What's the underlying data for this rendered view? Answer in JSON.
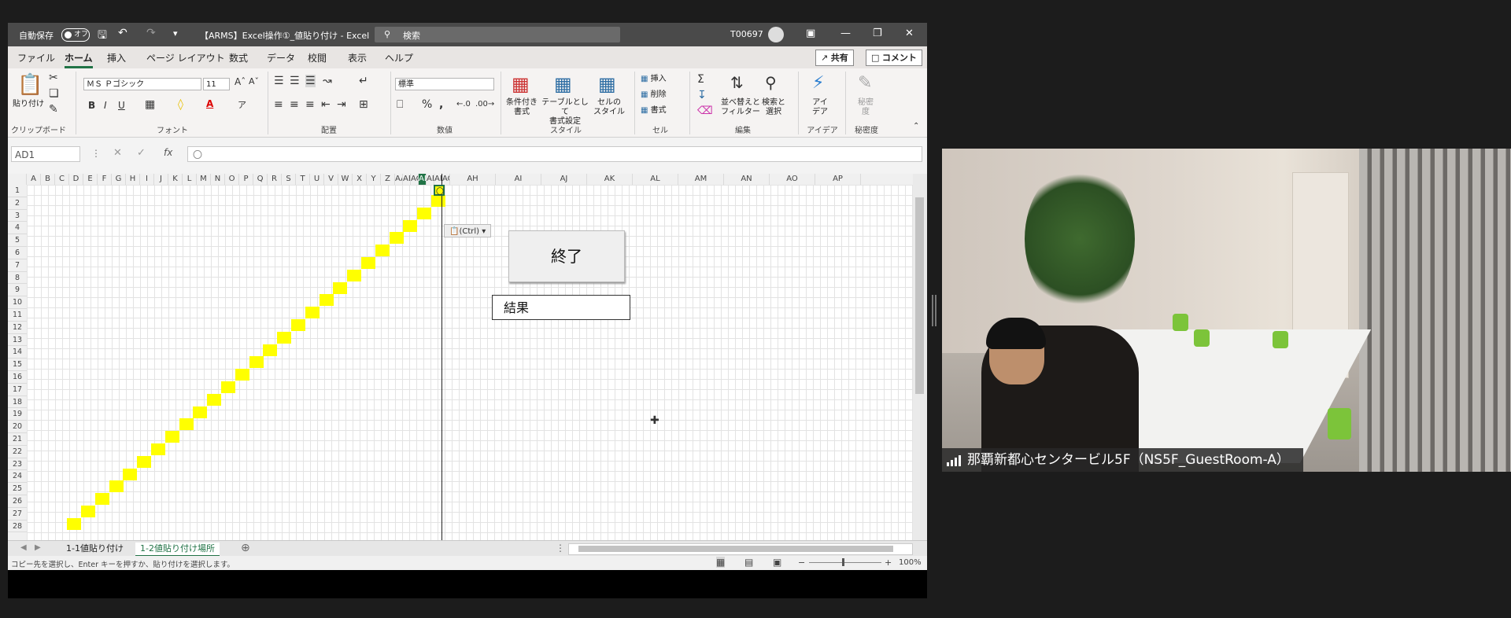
{
  "title_bar": {
    "autosave_label": "自動保存",
    "autosave_state": "オフ",
    "doc_title": "【ARMS】Excel操作①_値貼り付け  -  Excel",
    "search_placeholder": "検索",
    "user_id": "T00697"
  },
  "tabs": [
    "ファイル",
    "ホーム",
    "挿入",
    "ページ レイアウト",
    "数式",
    "データ",
    "校閲",
    "表示",
    "ヘルプ"
  ],
  "active_tab": "ホーム",
  "share_label": "共有",
  "comment_label": "コメント",
  "ribbon": {
    "clipboard": {
      "paste_label": "貼り付け",
      "group": "クリップボード"
    },
    "font": {
      "name": "ＭＳ Ｐゴシック",
      "size": "11",
      "group": "フォント",
      "bold": "B",
      "italic": "I",
      "underline": "U"
    },
    "alignment": {
      "group": "配置"
    },
    "number": {
      "format": "標準",
      "group": "数値"
    },
    "styles": {
      "conditional": "条件付き\n書式",
      "table": "テーブルとして\n書式設定",
      "cell": "セルの\nスタイル",
      "group": "スタイル"
    },
    "cells": {
      "insert": "挿入",
      "delete": "削除",
      "format": "書式",
      "group": "セル"
    },
    "editing": {
      "sort": "並べ替えと\nフィルター",
      "find": "検索と\n選択",
      "group": "編集"
    },
    "ideas": {
      "label": "アイ\nデア",
      "group": "アイデア"
    },
    "sensitivity": {
      "label": "秘密\n度",
      "group": "秘密度"
    }
  },
  "formula_bar": {
    "name_box": "AD1",
    "formula": "〇"
  },
  "columns": [
    "A",
    "B",
    "C",
    "D",
    "E",
    "F",
    "G",
    "H",
    "I",
    "J",
    "K",
    "L",
    "M",
    "N",
    "O",
    "P",
    "Q",
    "R",
    "S",
    "T",
    "U",
    "V",
    "W",
    "X",
    "Y",
    "Z",
    "AA",
    "AB",
    "AC",
    "AD",
    "AE",
    "AF",
    "AG",
    "AH",
    "AI",
    "AJ",
    "AK",
    "AL",
    "AM",
    "AN",
    "AO",
    "AP"
  ],
  "rows": [
    "1",
    "2",
    "3",
    "4",
    "5",
    "6",
    "7",
    "8",
    "9",
    "10",
    "11",
    "12",
    "13",
    "14",
    "15",
    "16",
    "17",
    "18",
    "19",
    "20",
    "21",
    "22",
    "23",
    "24",
    "25",
    "26",
    "27",
    "28"
  ],
  "active_cell_value": "〇",
  "paste_options_tag": "(Ctrl)",
  "end_button_label": "終了",
  "result_box_label": "結果",
  "sheets": [
    "1-1値貼り付け",
    "1-2値貼り付け場所"
  ],
  "active_sheet": "1-2値貼り付け場所",
  "status": {
    "message": "コピー先を選択し、Enter キーを押すか、貼り付けを選択します。",
    "zoom": "100%"
  },
  "video": {
    "caption": "那覇新都心センタービル5F（NS5F_GuestRoom-A）"
  },
  "colors": {
    "accent": "#217346",
    "highlight": "#ffff00"
  }
}
